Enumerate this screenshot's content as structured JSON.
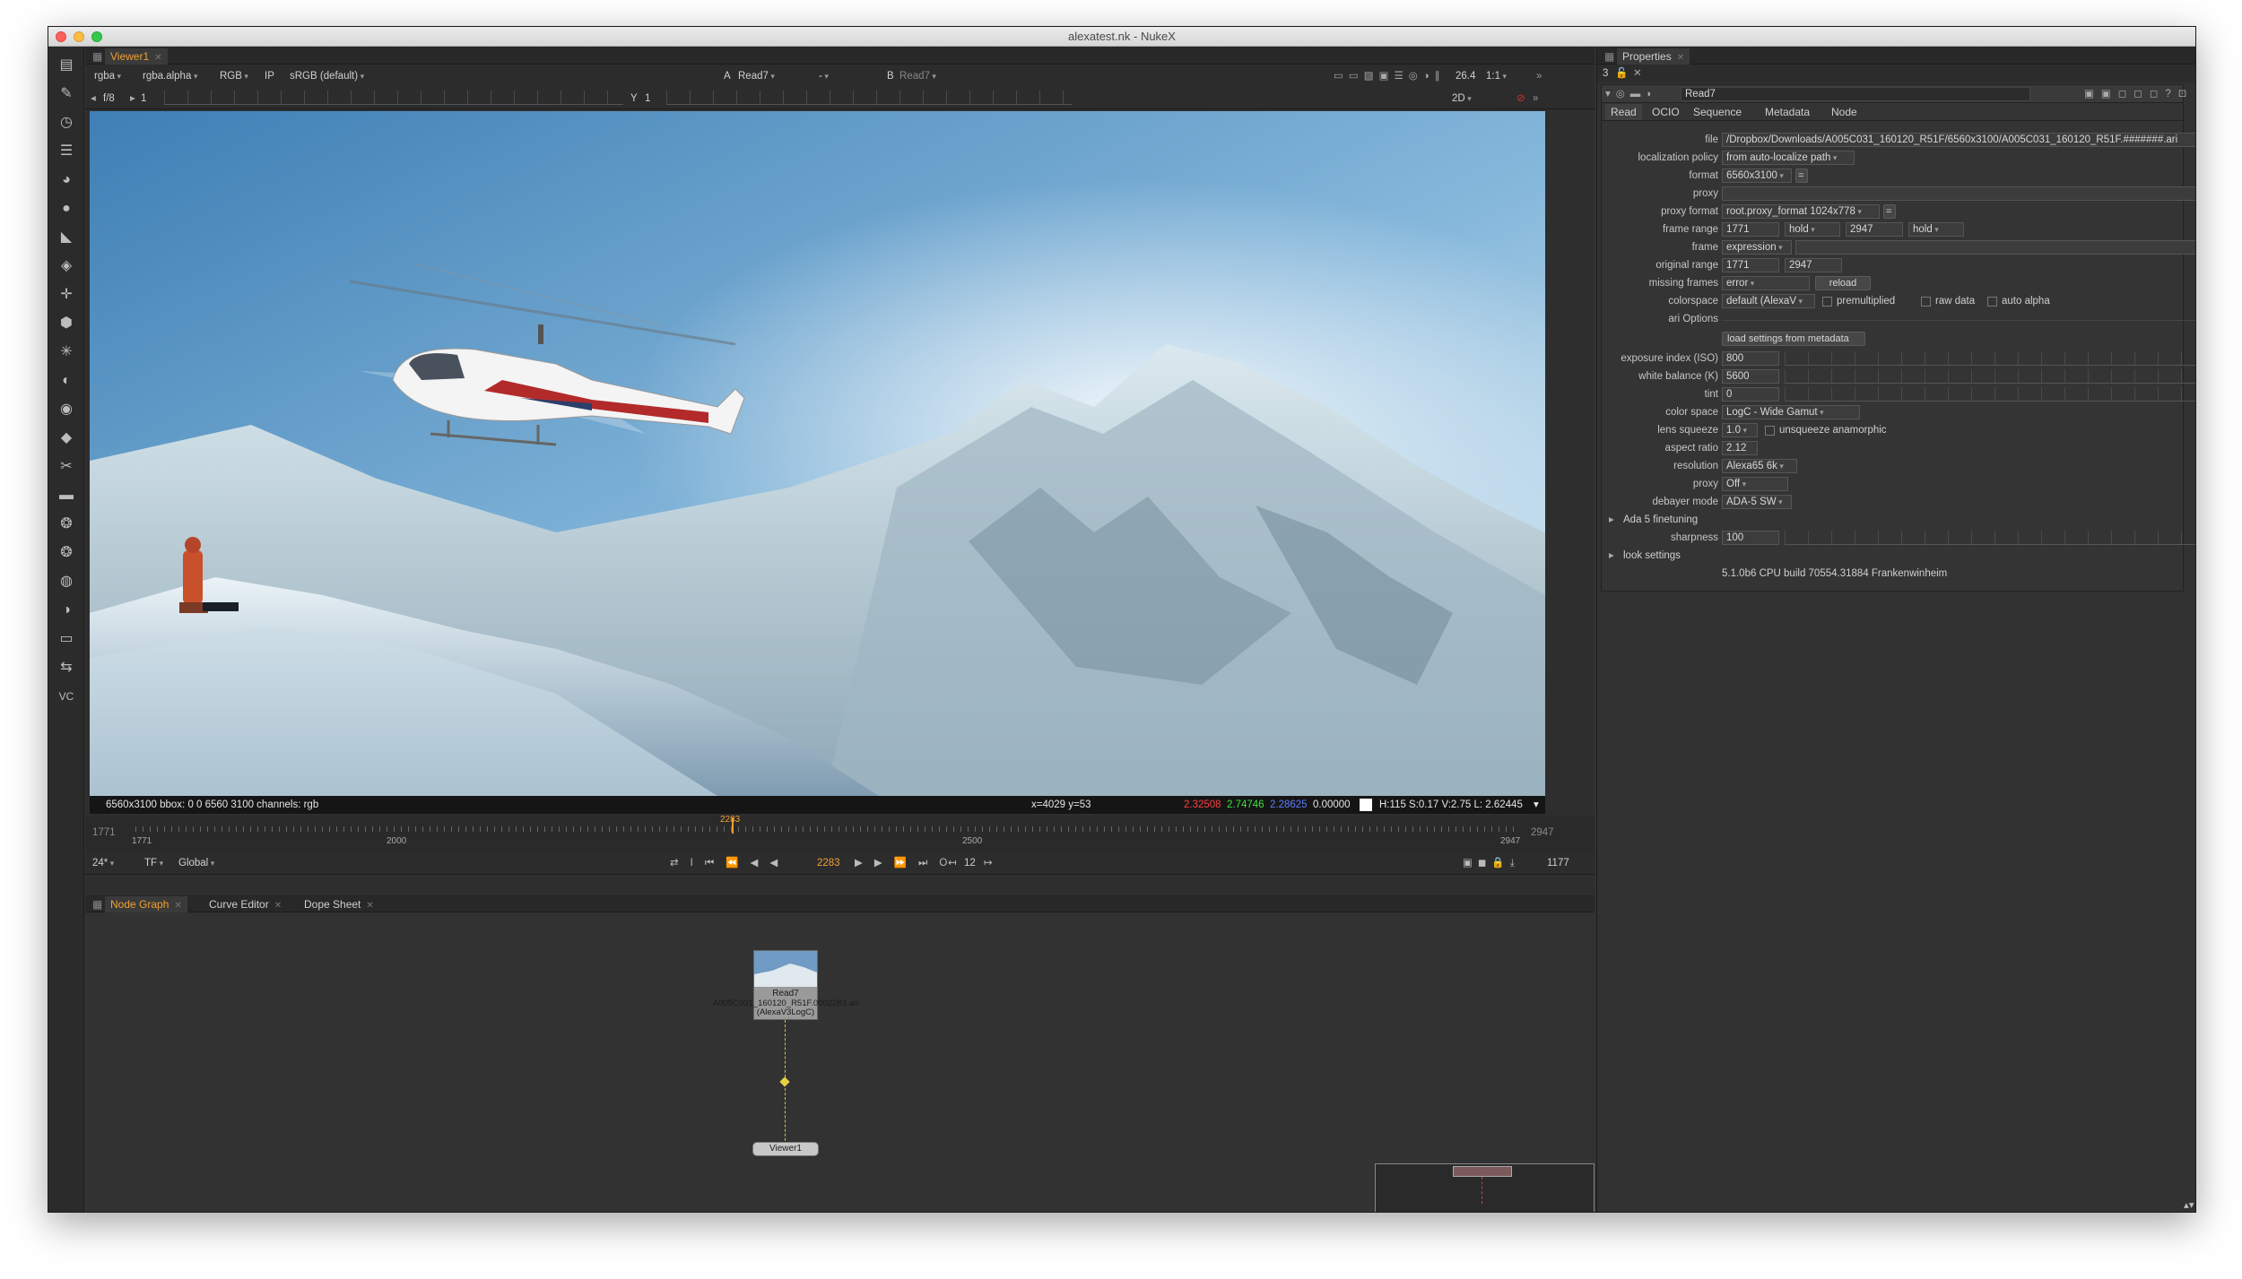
{
  "window": {
    "title": "alexatest.nk - NukeX"
  },
  "viewer": {
    "tab_label": "Viewer1",
    "channels": "rgba",
    "alpha_channel": "rgba.alpha",
    "display_channels": "RGB",
    "ip_label": "IP",
    "lut": "sRGB (default)",
    "input_a_label": "A",
    "input_a": "Read7",
    "compare_mode": "-",
    "input_b_label": "B",
    "input_b": "Read7",
    "zoom_value": "26.4",
    "ratio": "1:1",
    "fstop": "f/8",
    "frame_field": "1",
    "y_label": "Y",
    "y_field": "1",
    "view_mode": "2D",
    "info_left": "6560x3100   bbox: 0 0 6560 3100  channels: rgb",
    "cursor": "x=4029 y=53",
    "pixel_r": "2.32508",
    "pixel_g": "2.74746",
    "pixel_b": "2.28625",
    "pixel_a": "0.00000",
    "hsv": "H:115 S:0.17 V:2.75  L: 2.62445"
  },
  "timeline": {
    "start": "1771",
    "end": "2947",
    "labels": [
      "1771",
      "2000",
      "2500",
      "2947"
    ],
    "current": "2283",
    "fps": "24*",
    "tf": "TF",
    "global": "Global",
    "current_field": "2283",
    "skip_field": "12",
    "frames_total": "1177"
  },
  "bottom_tabs": {
    "node_graph": "Node Graph",
    "curve_editor": "Curve Editor",
    "dope_sheet": "Dope Sheet"
  },
  "nodes": {
    "read_label": "Read7",
    "read_file": "A005C031_160120_R51F.0002283.ari",
    "read_cs": "(AlexaV3LogC)",
    "viewer_label": "Viewer1"
  },
  "properties": {
    "panel_title": "Properties",
    "count": "3",
    "node_name": "Read7",
    "tabs": [
      "Read",
      "OCIO",
      "Sequence",
      "Metadata",
      "Node"
    ],
    "file_label": "file",
    "file": "/Dropbox/Downloads/A005C031_160120_R51F/6560x3100/A005C031_160120_R51F.#######.ari",
    "localization_label": "localization policy",
    "localization": "from auto-localize path",
    "format_label": "format",
    "format": "6560x3100",
    "proxy_label": "proxy",
    "proxy_format_label": "proxy format",
    "proxy_format": "root.proxy_format 1024x778",
    "frame_range_label": "frame range",
    "range_start": "1771",
    "range_start_mode": "hold",
    "range_end": "2947",
    "range_end_mode": "hold",
    "frame_label": "frame",
    "frame_mode": "expression",
    "original_range_label": "original range",
    "orig_start": "1771",
    "orig_end": "2947",
    "missing_frames_label": "missing frames",
    "missing_frames": "error",
    "reload": "reload",
    "colorspace_label": "colorspace",
    "colorspace": "default (AlexaV",
    "premultiplied": "premultiplied",
    "raw_data": "raw data",
    "auto_alpha": "auto alpha",
    "ari_options": "ari Options",
    "load_settings": "load settings from metadata",
    "exposure_label": "exposure index (ISO)",
    "exposure": "800",
    "wb_label": "white balance (K)",
    "wb": "5600",
    "tint_label": "tint",
    "tint": "0",
    "color_space_label": "color space",
    "color_space": "LogC - Wide Gamut",
    "lens_squeeze_label": "lens squeeze",
    "lens_squeeze": "1.0",
    "unsqueeze": "unsqueeze anamorphic",
    "aspect_label": "aspect ratio",
    "aspect": "2.12",
    "resolution_label": "resolution",
    "resolution": "Alexa65 6k",
    "proxy2_label": "proxy",
    "proxy2": "Off",
    "debayer_label": "debayer mode",
    "debayer": "ADA-5 SW",
    "ada_label": "Ada 5 finetuning",
    "sharpness_label": "sharpness",
    "sharpness": "100",
    "look_label": "look settings",
    "build": "5.1.0b6 CPU build 70554.31884 Frankenwinheim"
  }
}
